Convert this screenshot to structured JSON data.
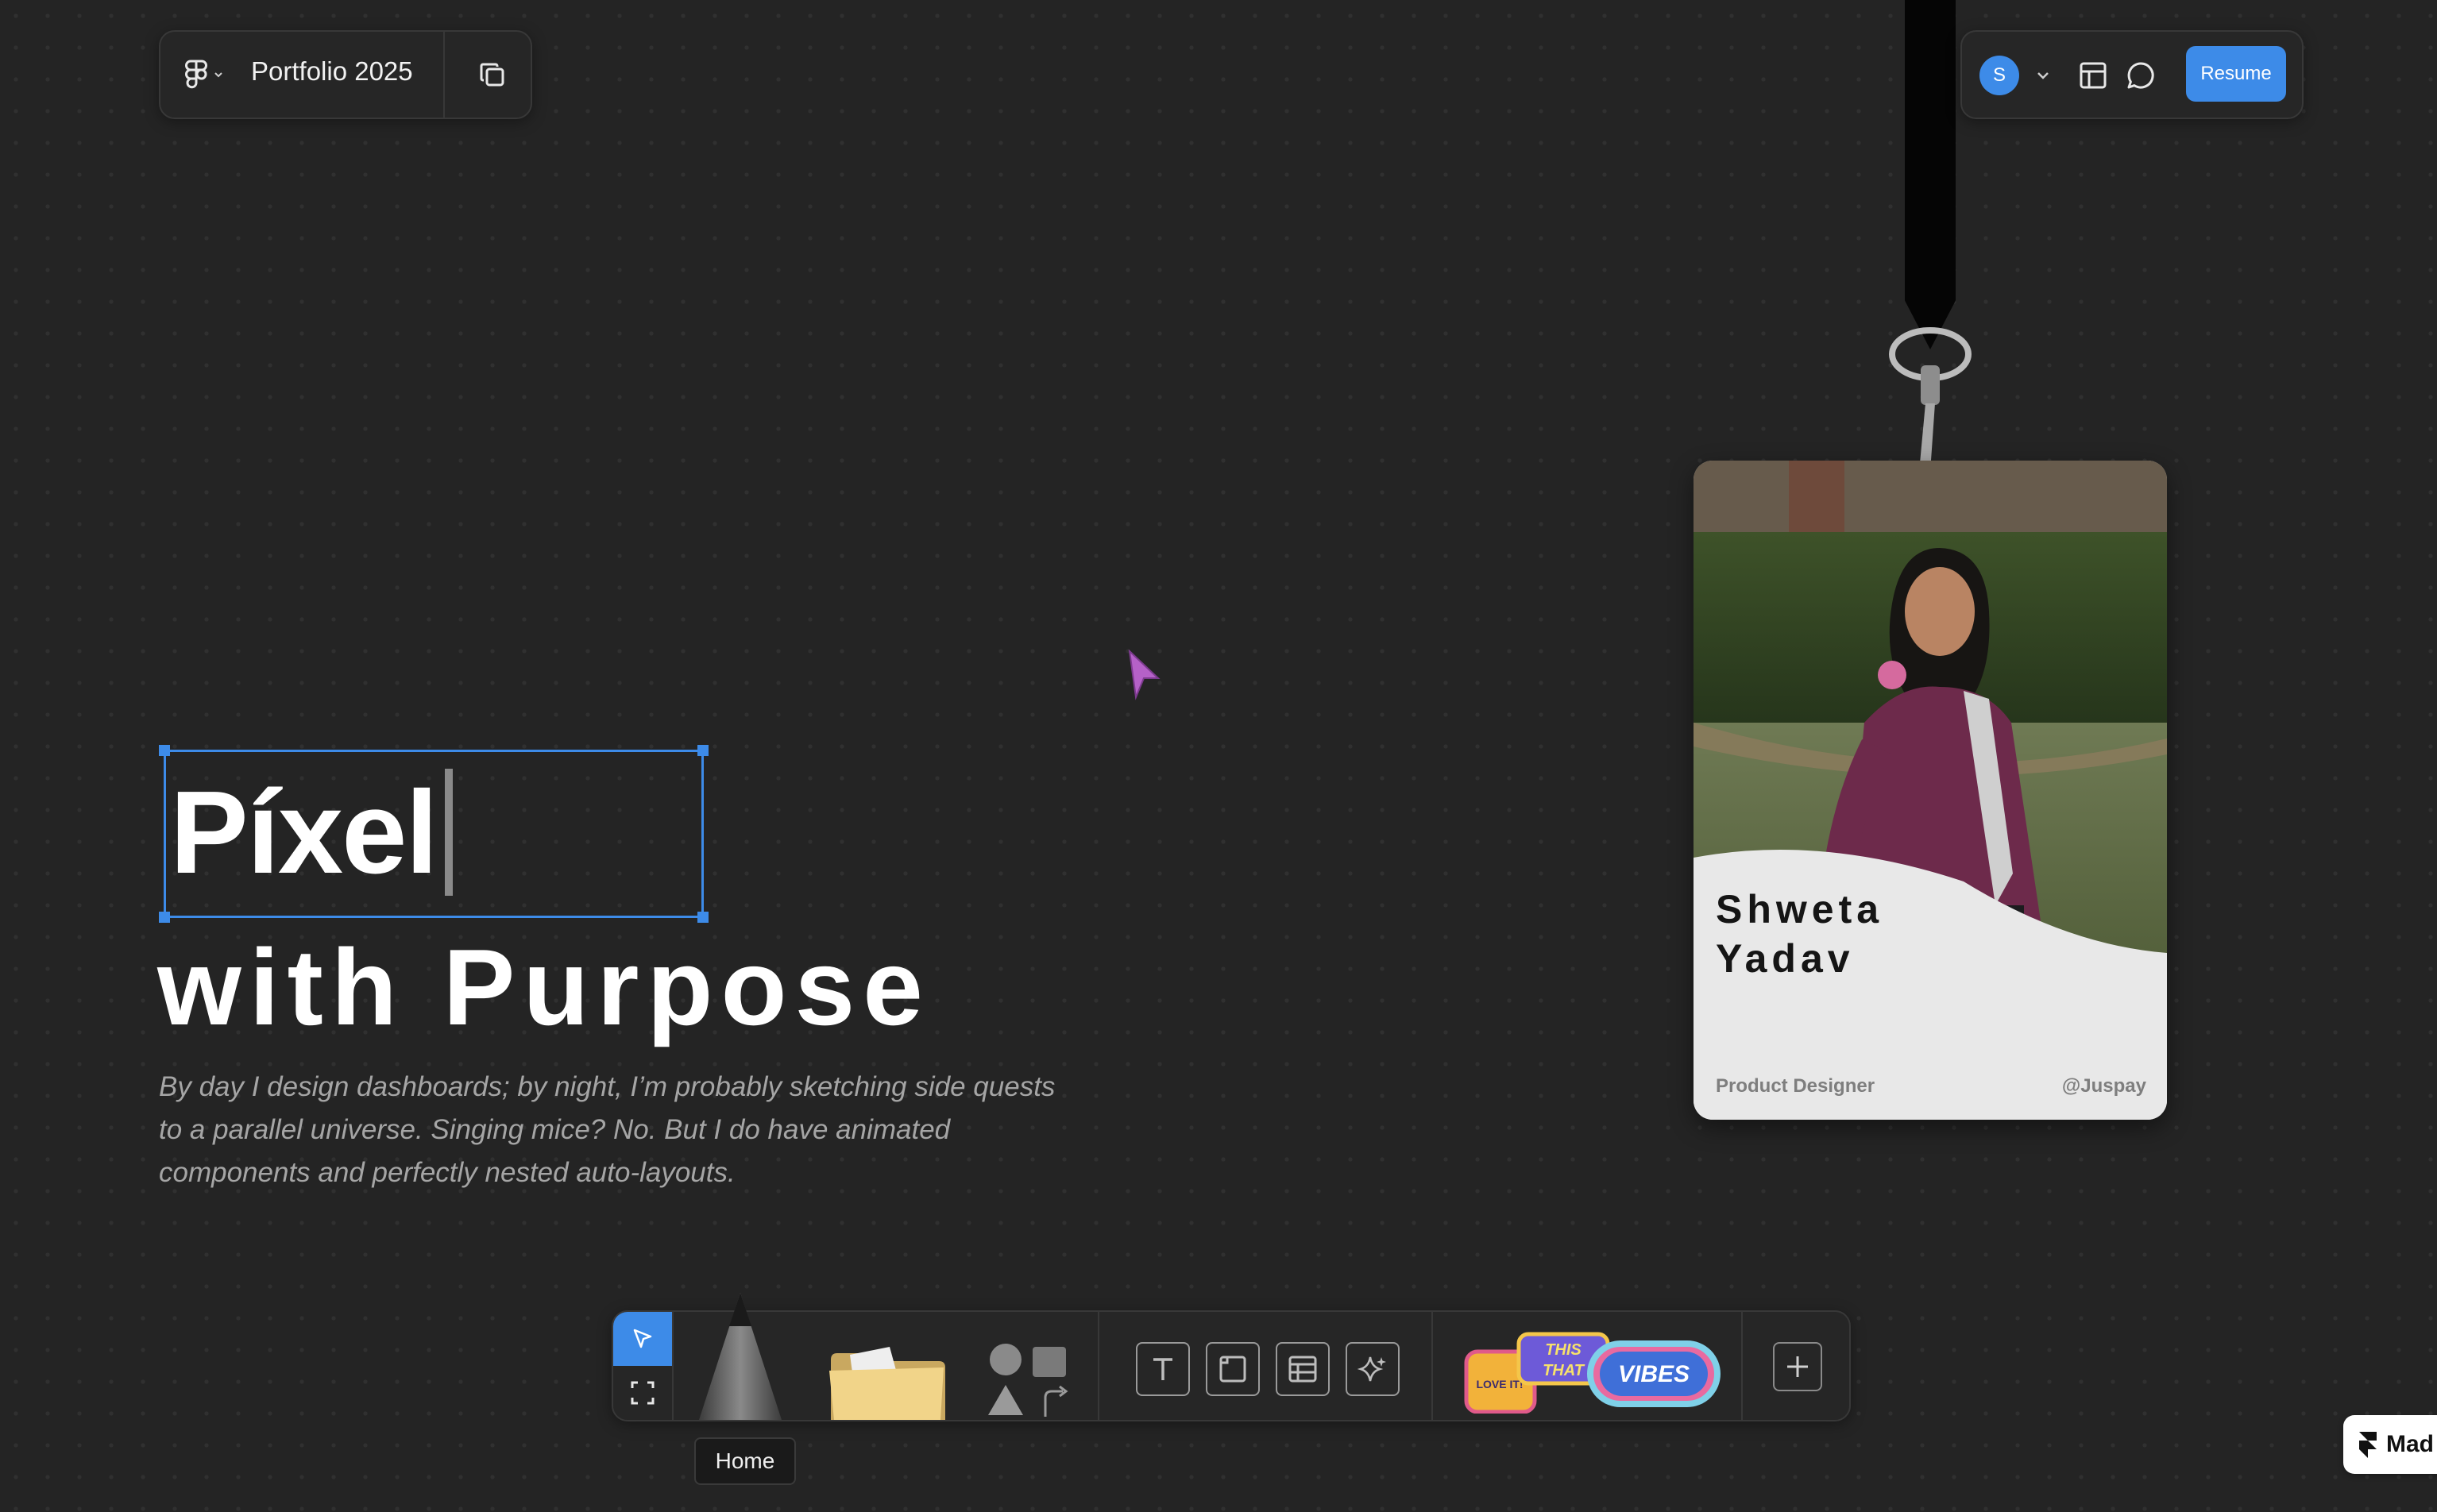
{
  "colors": {
    "background": "#242424",
    "accent": "#3d8be8",
    "panel": "#262626",
    "cursor": "#b561c8"
  },
  "header": {
    "app_icon": "figma-icon",
    "file_title": "Portfolio 2025",
    "duplicate_icon": "duplicate-icon"
  },
  "share": {
    "avatar_initial": "S",
    "layout_icon": "layout-icon",
    "comment_icon": "comment-icon",
    "resume_label": "Resume"
  },
  "hero": {
    "line1": "Píxel",
    "line2": "with Purpose",
    "description": "By day I design dashboards; by night, I’m probably sketching side quests to a parallel universe. Singing mice? No. But I do have animated components and perfectly nested auto-layouts."
  },
  "badge": {
    "first_name": "Shweta",
    "last_name": "Yadav",
    "role": "Product Designer",
    "handle": "@Juspay"
  },
  "toolbar": {
    "tools": [
      "select-icon",
      "frame-icon",
      "pencil-icon",
      "folder-icon",
      "shapes-icon",
      "text-icon",
      "frame-box-icon",
      "table-icon",
      "sparkle-icon",
      "stickers",
      "add-icon"
    ],
    "tooltip": "Home"
  },
  "made_badge": {
    "label": "Mad"
  }
}
